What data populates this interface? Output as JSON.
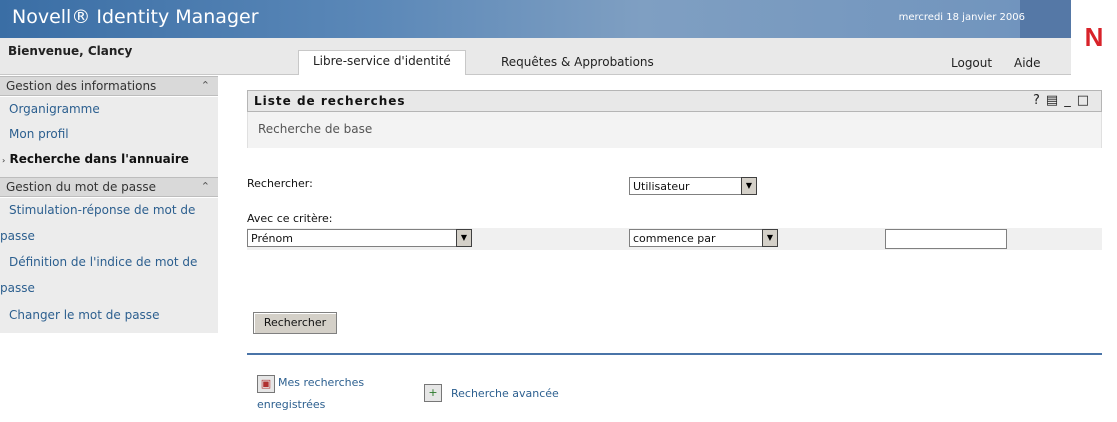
{
  "header": {
    "app_title": "Novell® Identity Manager",
    "date": "mercredi 18 janvier 2006",
    "logo_letter": "N"
  },
  "topbar": {
    "welcome": "Bienvenue, Clancy",
    "tabs": [
      {
        "label": "Libre-service d'identité",
        "active": true
      },
      {
        "label": "Requêtes & Approbations",
        "active": false
      }
    ],
    "logout": "Logout",
    "help": "Aide"
  },
  "sidebar": {
    "section1": {
      "title": "Gestion des informations",
      "items": [
        {
          "label": "Organigramme"
        },
        {
          "label": "Mon profil"
        },
        {
          "label": "Recherche dans l'annuaire",
          "current": true
        }
      ]
    },
    "section2": {
      "title": "Gestion du mot de passe",
      "items": [
        {
          "line1": "Stimulation-réponse de mot de",
          "line2": "passe"
        },
        {
          "line1": "Définition de l'indice de mot de",
          "line2": "passe"
        },
        {
          "line1": "Changer le mot de passe"
        }
      ]
    }
  },
  "panel": {
    "title": "Liste de recherches",
    "icons": [
      "help-icon",
      "print-icon",
      "minimize-icon",
      "maximize-icon"
    ],
    "subtitle": "Recherche de base",
    "search_label": "Rechercher:",
    "search_type": "Utilisateur",
    "criteria_label": "Avec ce critère:",
    "criteria_field": "Prénom",
    "criteria_operator": "commence par",
    "criteria_value": "",
    "search_button": "Rechercher",
    "saved_searches_line1": "Mes recherches",
    "saved_searches_line2": "enregistrées",
    "advanced_search": "Recherche avancée"
  },
  "colors": {
    "banner": "#3a6ea5",
    "link": "#2c5f8f",
    "divider": "#4a74a8",
    "logo": "#d8232a"
  }
}
